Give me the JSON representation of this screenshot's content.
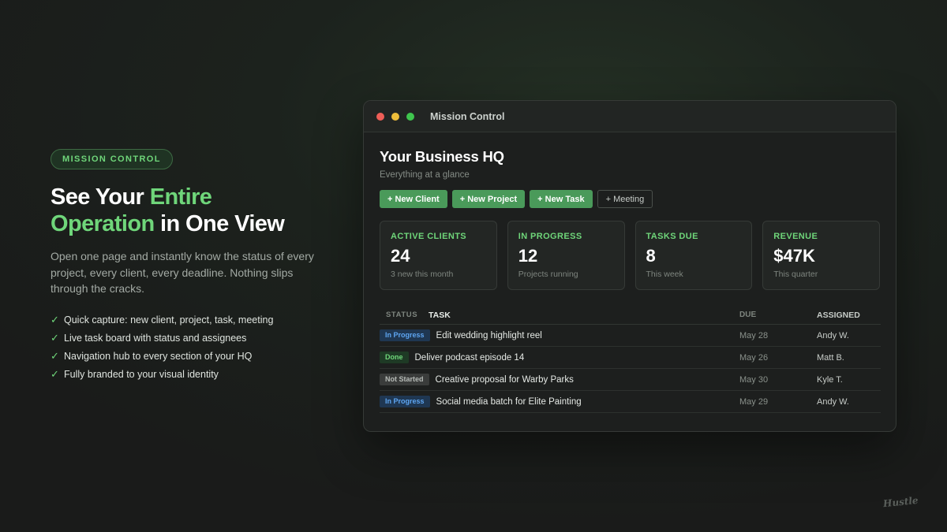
{
  "hero": {
    "pill": "MISSION CONTROL",
    "headline": {
      "part1": "See Your ",
      "accent1": "Entire",
      "accent2": "Operation",
      "part2": " in One View"
    },
    "lede": "Open one page and instantly know the status of every project, every client, every deadline. Nothing slips through the cracks.",
    "features": [
      "Quick capture: new client, project, task, meeting",
      "Live task board with status and assignees",
      "Navigation hub to every section of your HQ",
      "Fully branded to your visual identity"
    ],
    "check_icon": "check-icon"
  },
  "window": {
    "title": "Mission Control",
    "heading": "Your Business HQ",
    "subheading": "Everything at a glance",
    "actions": [
      "+ New Client",
      "+ New Project",
      "+ New Task",
      "+ Meeting"
    ],
    "stats": [
      {
        "label": "ACTIVE CLIENTS",
        "value": "24",
        "note": "3 new this month"
      },
      {
        "label": "IN PROGRESS",
        "value": "12",
        "note": "Projects running"
      },
      {
        "label": "TASKS DUE",
        "value": "8",
        "note": "This week"
      },
      {
        "label": "REVENUE",
        "value": "$47K",
        "note": "This quarter"
      }
    ],
    "table": {
      "headers": {
        "status": "STATUS",
        "task": "TASK",
        "due": "DUE",
        "assigned": "ASSIGNED"
      },
      "rows": [
        {
          "status": "In Progress",
          "task": "Edit wedding highlight reel",
          "due": "May 28",
          "assigned": "Andy W."
        },
        {
          "status": "Done",
          "task": "Deliver podcast episode 14",
          "due": "May 26",
          "assigned": "Matt B."
        },
        {
          "status": "Not Started",
          "task": "Creative proposal for Warby Parks",
          "due": "May 30",
          "assigned": "Kyle T."
        },
        {
          "status": "In Progress",
          "task": "Social media batch for Elite Painting",
          "due": "May 29",
          "assigned": "Andy W."
        }
      ]
    }
  },
  "brand": {
    "logo_text": "Hustle"
  },
  "colors": {
    "accent": "#6fd67a",
    "button": "#4a9a5a",
    "in_progress": "#5ea6f2",
    "done": "#6fd67a",
    "not_started": "#b6bbb7"
  }
}
